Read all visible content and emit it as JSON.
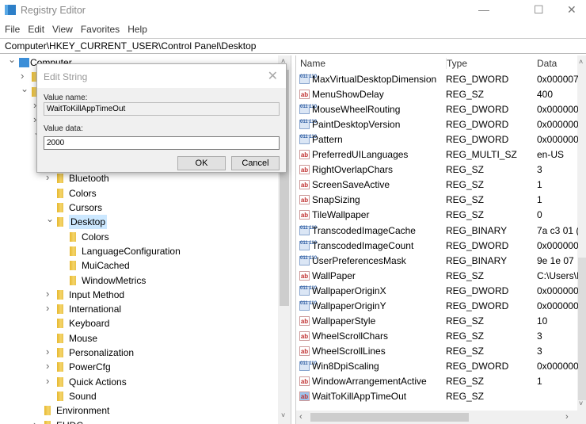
{
  "window": {
    "title": "Registry Editor",
    "minimize": "—",
    "maximize": "☐",
    "close": "✕"
  },
  "menu": [
    "File",
    "Edit",
    "View",
    "Favorites",
    "Help"
  ],
  "address": "Computer\\HKEY_CURRENT_USER\\Control Panel\\Desktop",
  "tree": [
    {
      "label": "Computer",
      "level": 0,
      "chev": "v",
      "icon": "computer"
    },
    {
      "label": "",
      "level": 1,
      "chev": ">"
    },
    {
      "label": "",
      "level": 1,
      "chev": "v"
    },
    {
      "label": "",
      "level": 2,
      "chev": ">"
    },
    {
      "label": "",
      "level": 2,
      "chev": ">"
    },
    {
      "label": "",
      "level": 2,
      "chev": "v"
    },
    {
      "label": "",
      "level": 3,
      "chev": ""
    },
    {
      "label": "",
      "level": 3,
      "chev": ""
    },
    {
      "label": "Bluetooth",
      "level": 3,
      "chev": ">"
    },
    {
      "label": "Colors",
      "level": 3,
      "chev": ""
    },
    {
      "label": "Cursors",
      "level": 3,
      "chev": ""
    },
    {
      "label": "Desktop",
      "level": 3,
      "chev": "v",
      "selected": true
    },
    {
      "label": "Colors",
      "level": 4,
      "chev": ""
    },
    {
      "label": "LanguageConfiguration",
      "level": 4,
      "chev": ""
    },
    {
      "label": "MuiCached",
      "level": 4,
      "chev": ""
    },
    {
      "label": "WindowMetrics",
      "level": 4,
      "chev": ""
    },
    {
      "label": "Input Method",
      "level": 3,
      "chev": ">"
    },
    {
      "label": "International",
      "level": 3,
      "chev": ">"
    },
    {
      "label": "Keyboard",
      "level": 3,
      "chev": ""
    },
    {
      "label": "Mouse",
      "level": 3,
      "chev": ""
    },
    {
      "label": "Personalization",
      "level": 3,
      "chev": ">"
    },
    {
      "label": "PowerCfg",
      "level": 3,
      "chev": ">"
    },
    {
      "label": "Quick Actions",
      "level": 3,
      "chev": ">"
    },
    {
      "label": "Sound",
      "level": 3,
      "chev": ""
    },
    {
      "label": "Environment",
      "level": 2,
      "chev": ""
    },
    {
      "label": "EUDC",
      "level": 2,
      "chev": ">"
    }
  ],
  "columns": {
    "name": "Name",
    "type": "Type",
    "data": "Data"
  },
  "values": [
    {
      "name": "MaxVirtualDesktopDimension",
      "type": "REG_DWORD",
      "data": "0x000007",
      "icon": "binary"
    },
    {
      "name": "MenuShowDelay",
      "type": "REG_SZ",
      "data": "400",
      "icon": "string"
    },
    {
      "name": "MouseWheelRouting",
      "type": "REG_DWORD",
      "data": "0x000000",
      "icon": "binary"
    },
    {
      "name": "PaintDesktopVersion",
      "type": "REG_DWORD",
      "data": "0x000000",
      "icon": "binary"
    },
    {
      "name": "Pattern",
      "type": "REG_DWORD",
      "data": "0x000000",
      "icon": "binary"
    },
    {
      "name": "PreferredUILanguages",
      "type": "REG_MULTI_SZ",
      "data": "en-US",
      "icon": "string"
    },
    {
      "name": "RightOverlapChars",
      "type": "REG_SZ",
      "data": "3",
      "icon": "string"
    },
    {
      "name": "ScreenSaveActive",
      "type": "REG_SZ",
      "data": "1",
      "icon": "string"
    },
    {
      "name": "SnapSizing",
      "type": "REG_SZ",
      "data": "1",
      "icon": "string"
    },
    {
      "name": "TileWallpaper",
      "type": "REG_SZ",
      "data": "0",
      "icon": "string"
    },
    {
      "name": "TranscodedImageCache",
      "type": "REG_BINARY",
      "data": "7a c3 01 (",
      "icon": "binary"
    },
    {
      "name": "TranscodedImageCount",
      "type": "REG_DWORD",
      "data": "0x000000",
      "icon": "binary"
    },
    {
      "name": "UserPreferencesMask",
      "type": "REG_BINARY",
      "data": "9e 1e 07",
      "icon": "binary"
    },
    {
      "name": "WallPaper",
      "type": "REG_SZ",
      "data": "C:\\Users\\I",
      "icon": "string"
    },
    {
      "name": "WallpaperOriginX",
      "type": "REG_DWORD",
      "data": "0x000000",
      "icon": "binary"
    },
    {
      "name": "WallpaperOriginY",
      "type": "REG_DWORD",
      "data": "0x000000",
      "icon": "binary"
    },
    {
      "name": "WallpaperStyle",
      "type": "REG_SZ",
      "data": "10",
      "icon": "string"
    },
    {
      "name": "WheelScrollChars",
      "type": "REG_SZ",
      "data": "3",
      "icon": "string"
    },
    {
      "name": "WheelScrollLines",
      "type": "REG_SZ",
      "data": "3",
      "icon": "string"
    },
    {
      "name": "Win8DpiScaling",
      "type": "REG_DWORD",
      "data": "0x000000",
      "icon": "binary"
    },
    {
      "name": "WindowArrangementActive",
      "type": "REG_SZ",
      "data": "1",
      "icon": "string"
    },
    {
      "name": "WaitToKillAppTimeOut",
      "type": "REG_SZ",
      "data": "",
      "icon": "string",
      "selected": true
    }
  ],
  "dialog": {
    "title": "Edit String",
    "close": "✕",
    "value_name_label": "Value name:",
    "value_name": "WaitToKillAppTimeOut",
    "value_data_label": "Value data:",
    "value_data": "2000",
    "ok": "OK",
    "cancel": "Cancel"
  },
  "icons": {
    "string": "ab",
    "binary": "011 110"
  }
}
